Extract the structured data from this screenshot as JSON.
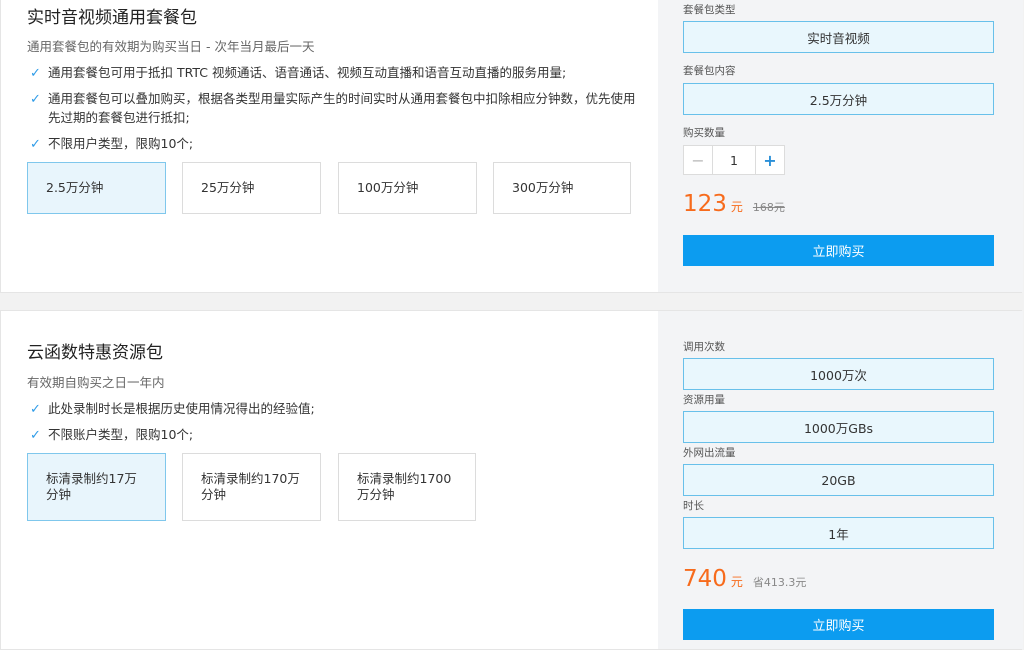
{
  "pack1": {
    "title": "实时音视频通用套餐包",
    "desc": "通用套餐包的有效期为购买当日 - 次年当月最后一天",
    "features": [
      "通用套餐包可用于抵扣 TRTC 视频通话、语音通话、视频互动直播和语音互动直播的服务用量;",
      "通用套餐包可以叠加购买，根据各类型用量实际产生的时间实时从通用套餐包中扣除相应分钟数，优先使用先过期的套餐包进行抵扣;",
      "不限用户类型，限购10个;"
    ],
    "options": [
      "2.5万分钟",
      "25万分钟",
      "100万分钟",
      "300万分钟"
    ],
    "selected_option": "2.5万分钟",
    "type_label": "套餐包类型",
    "type_value": "实时音视频",
    "content_label": "套餐包内容",
    "content_value": "2.5万分钟",
    "qty_label": "购买数量",
    "qty_minus": "−",
    "qty_value": "1",
    "qty_plus": "+",
    "price": "123",
    "unit": "元",
    "original_price": "168元",
    "buy_label": "立即购买"
  },
  "pack2": {
    "title": "云函数特惠资源包",
    "desc": "有效期自购买之日一年内",
    "features": [
      "此处录制时长是根据历史使用情况得出的经验值;",
      "不限账户类型，限购10个;"
    ],
    "options": [
      "标清录制约17万分钟",
      "标清录制约170万分钟",
      "标清录制约1700万分钟"
    ],
    "selected_option": "标清录制约17万分钟",
    "calls_label": "调用次数",
    "calls_value": "1000万次",
    "resource_label": "资源用量",
    "resource_value": "1000万GBs",
    "traffic_label": "外网出流量",
    "traffic_value": "20GB",
    "duration_label": "时长",
    "duration_value": "1年",
    "price": "740",
    "unit": "元",
    "save": "省413.3元",
    "buy_label": "立即购买"
  },
  "icons": {
    "check": "check-icon"
  },
  "colors": {
    "accent": "#0c9cf0",
    "price": "#f76b1c",
    "selected_bg": "#e8f5fc"
  }
}
